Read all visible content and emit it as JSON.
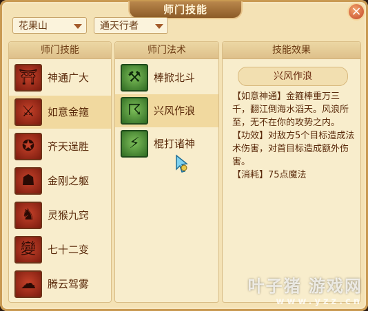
{
  "window": {
    "title": "师门技能",
    "close_icon": "close-icon"
  },
  "filters": [
    {
      "label": "花果山"
    },
    {
      "label": "通天行者"
    }
  ],
  "headers": {
    "skills": "师门技能",
    "spells": "师门法术",
    "effect": "技能效果"
  },
  "skills": [
    {
      "label": "神通广大",
      "icon": "staff-emblem-icon",
      "glyph": "⛩",
      "selected": false
    },
    {
      "label": "如意金箍",
      "icon": "golden-staff-icon",
      "glyph": "⚔",
      "selected": true
    },
    {
      "label": "齐天逞胜",
      "icon": "monkey-king-icon",
      "glyph": "✪",
      "selected": false
    },
    {
      "label": "金刚之躯",
      "icon": "vajra-body-icon",
      "glyph": "☗",
      "selected": false
    },
    {
      "label": "灵猴九窍",
      "icon": "spirit-monkey-icon",
      "glyph": "♞",
      "selected": false
    },
    {
      "label": "七十二变",
      "icon": "seventy-two-transformations-icon",
      "glyph": "變",
      "selected": false
    },
    {
      "label": "腾云驾雾",
      "icon": "cloud-riding-icon",
      "glyph": "☁",
      "selected": false
    }
  ],
  "spells": [
    {
      "label": "棒掀北斗",
      "icon": "staff-sweep-icon",
      "glyph": "⚒",
      "selected": false
    },
    {
      "label": "兴风作浪",
      "icon": "wind-wave-icon",
      "glyph": "☈",
      "selected": true
    },
    {
      "label": "棍打诸神",
      "icon": "staff-strike-icon",
      "glyph": "⚡",
      "selected": false
    }
  ],
  "effect": {
    "title": "兴风作浪",
    "lines": [
      "【如意神通】金箍棒重万三千，翻江倒海水滔天。风浪所至，无不在你的攻势之内。",
      "【功效】对敌方5个目标造成法术伤害，对首目标造成额外伤害。",
      "【消耗】75点魔法"
    ]
  },
  "watermark": {
    "title": "叶子猪 游戏网",
    "url": "www.yzz.cn"
  },
  "colors": {
    "frame": "#c99a52",
    "panel": "#f8edcc",
    "selected": "#f1d99f",
    "text": "#5a2a0b"
  }
}
